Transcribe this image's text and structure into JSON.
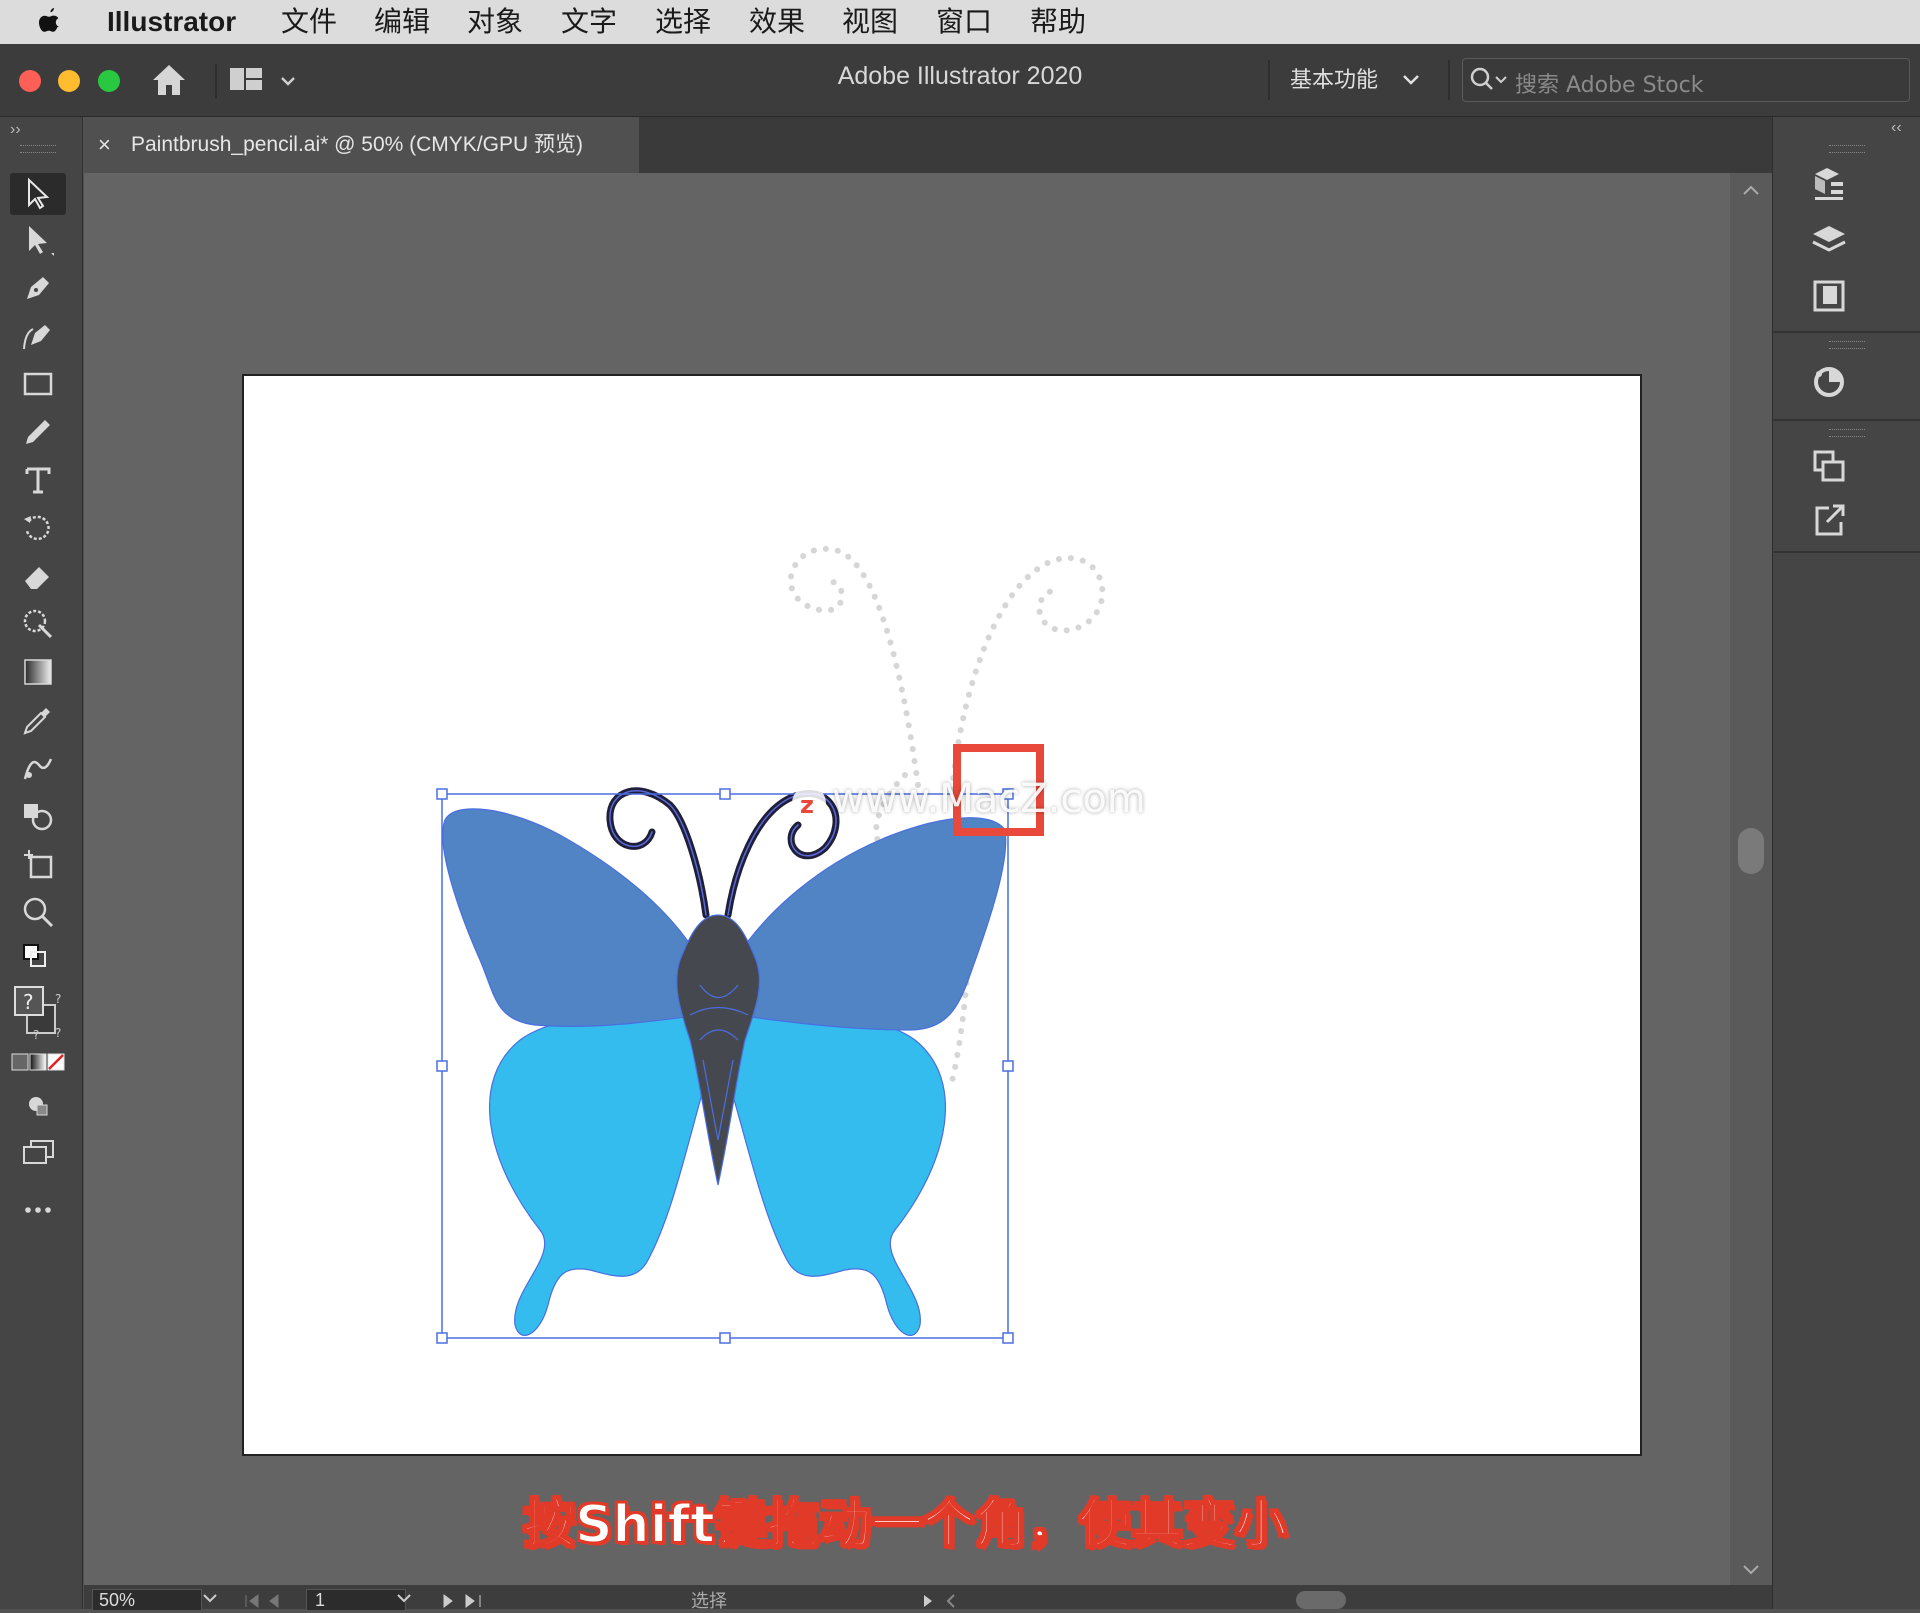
{
  "menubar": {
    "app_name": "Illustrator",
    "items": [
      "文件",
      "编辑",
      "对象",
      "文字",
      "选择",
      "效果",
      "视图",
      "窗口",
      "帮助"
    ]
  },
  "appbar": {
    "title": "Adobe Illustrator 2020",
    "workspace": "基本功能",
    "search_placeholder": "搜索 Adobe Stock"
  },
  "document_tab": {
    "close": "×",
    "label": "Paintbrush_pencil.ai* @ 50% (CMYK/GPU 预览)"
  },
  "statusbar": {
    "zoom": "50%",
    "artboard_number": "1",
    "tool_status": "选择"
  },
  "overlay": {
    "caption": "按Shift键拖动一个角，使其变小",
    "watermark": "www.MacZ.com"
  },
  "colors": {
    "wing_upper": "#5084c4",
    "wing_lower": "#35bcee",
    "body": "#45494f",
    "selection": "#4a6ee0",
    "highlight": "#e8493a"
  },
  "icons": {
    "tools": [
      "selection",
      "direct-selection",
      "pen",
      "curvature",
      "rectangle",
      "pencil",
      "type",
      "rotate",
      "eraser",
      "lasso-zoom",
      "gradient",
      "eyedropper",
      "blend",
      "shape-builder",
      "artboard",
      "zoom"
    ],
    "right_panels": [
      "libraries",
      "layers",
      "artboards",
      "color-guide",
      "transform",
      "export"
    ]
  }
}
